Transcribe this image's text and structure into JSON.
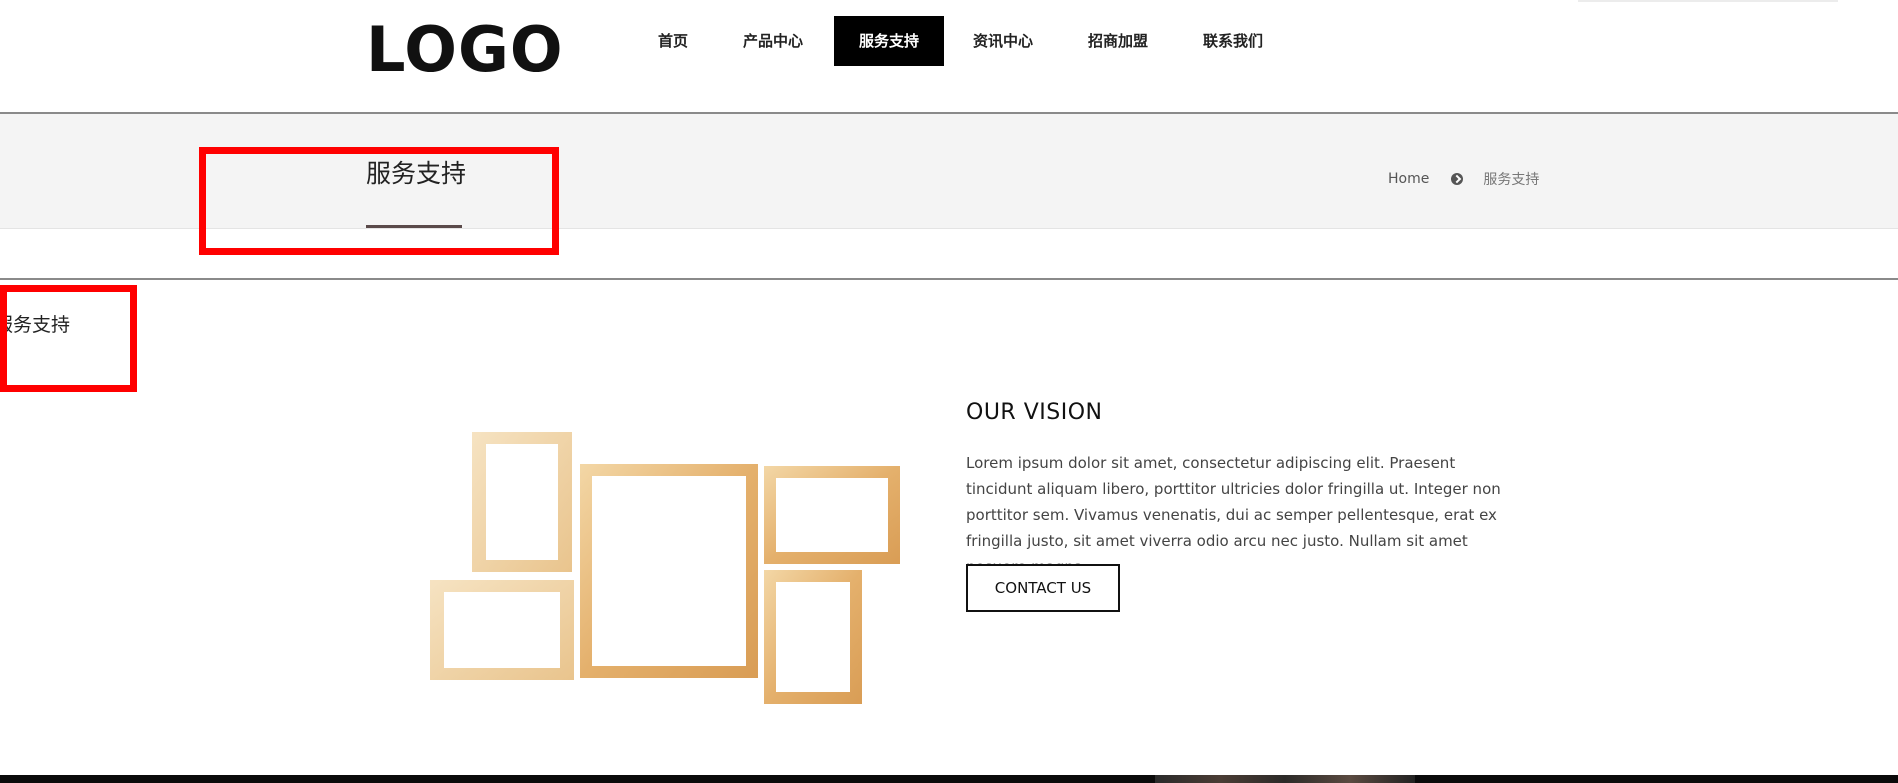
{
  "header": {
    "logo": "LOGO",
    "nav": [
      {
        "label": "首页",
        "active": false
      },
      {
        "label": "产品中心",
        "active": false
      },
      {
        "label": "服务支持",
        "active": true
      },
      {
        "label": "资讯中心",
        "active": false
      },
      {
        "label": "招商加盟",
        "active": false
      },
      {
        "label": "联系我们",
        "active": false
      }
    ]
  },
  "banner": {
    "title": "服务支持",
    "breadcrumb": {
      "home": "Home",
      "current": "服务支持"
    }
  },
  "side_label": "服务支持",
  "vision": {
    "title": "OUR VISION",
    "text": "Lorem ipsum dolor sit amet, consectetur adipiscing elit. Praesent tincidunt aliquam libero, porttitor ultricies dolor fringilla ut. Integer non porttitor sem. Vivamus venenatis, dui ac semper pellentesque, erat ex fringilla justo, sit amet viverra odio arcu nec justo. Nullam sit amet posuere magna.",
    "button": "CONTACT US"
  },
  "colors": {
    "nav_active_bg": "#000000",
    "banner_bg": "#f4f4f4",
    "highlight_box": "#ff0000",
    "frame_wood": "#e7b774"
  }
}
